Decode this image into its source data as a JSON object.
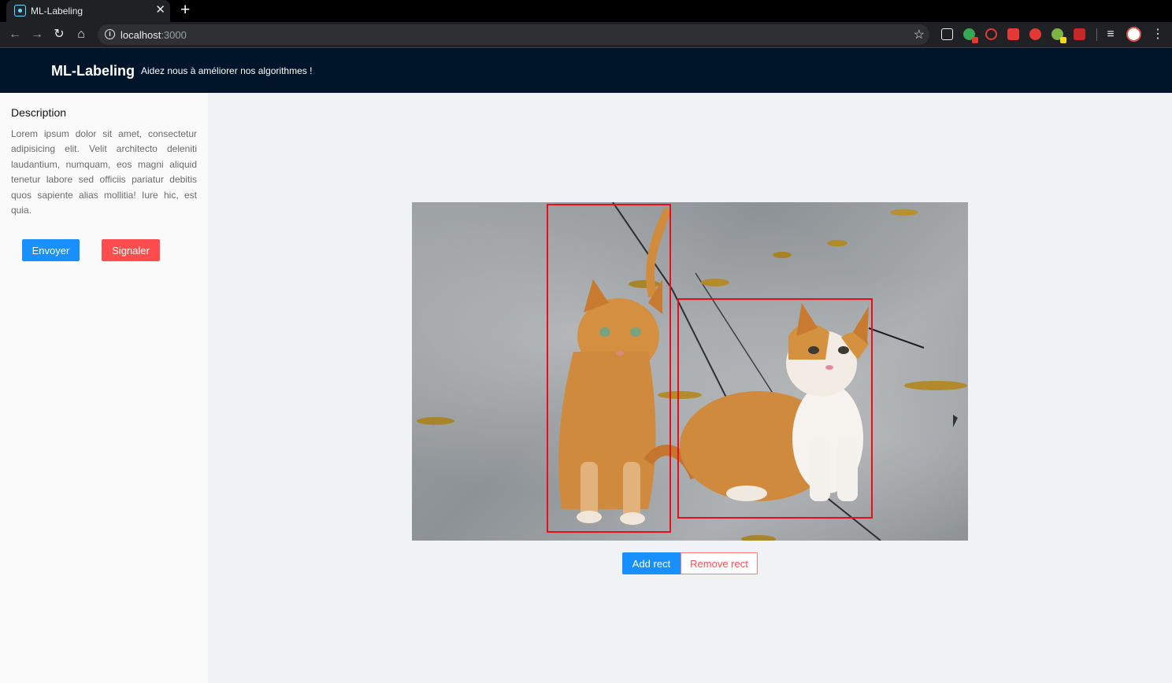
{
  "browser": {
    "tab_title": "ML-Labeling",
    "close_glyph": "✕",
    "newtab_glyph": "+",
    "url_host": "localhost",
    "url_port": ":3000",
    "icons": {
      "back": "back-arrow-icon",
      "forward": "forward-arrow-icon",
      "reload": "reload-icon",
      "home": "home-icon",
      "info": "info-icon",
      "star": "bookmark-star-icon",
      "menu": "kebab-menu-icon"
    }
  },
  "header": {
    "brand": "ML-Labeling",
    "tagline": "Aidez nous à améliorer nos algorithmes !"
  },
  "sidebar": {
    "title": "Description",
    "description": "Lorem ipsum dolor sit amet, consectetur adipisicing elit. Velit architecto deleniti laudantium, numquam, eos magni aliquid tenetur labore sed officiis pariatur debitis quos sapiente alias mollitia! Iure hic, est quia.",
    "send_label": "Envoyer",
    "report_label": "Signaler"
  },
  "labeling": {
    "bbox_color": "#e6101a",
    "add_label": "Add rect",
    "remove_label": "Remove rect"
  },
  "colors": {
    "header_bg": "#001529",
    "primary": "#1890ff",
    "danger": "#ff4d4f"
  }
}
